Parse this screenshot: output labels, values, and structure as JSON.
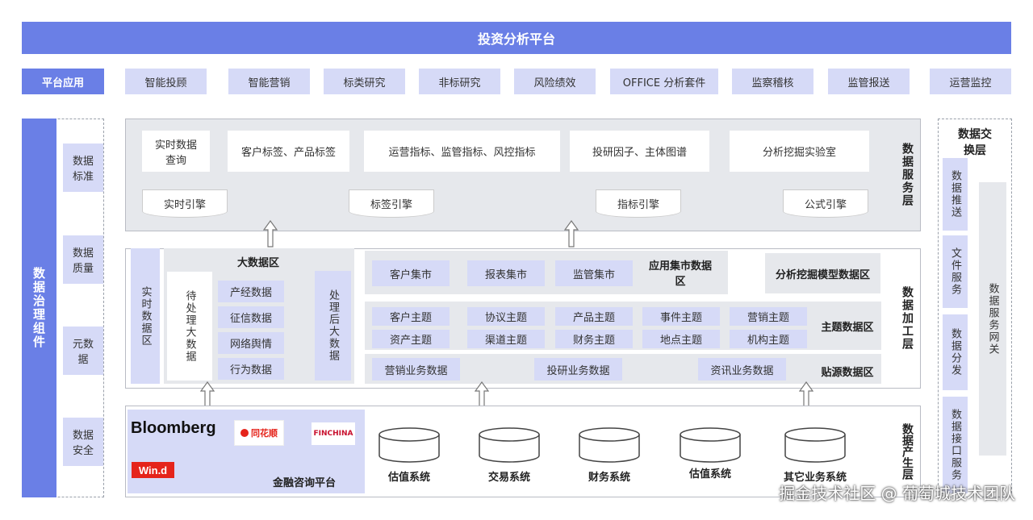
{
  "title": "投资分析平台",
  "platform_apps": {
    "label": "平台应用",
    "items": [
      "智能投顾",
      "智能营销",
      "标类研究",
      "非标研究",
      "风险绩效",
      "OFFICE 分析套件",
      "监察稽核",
      "监管报送",
      "运营监控"
    ]
  },
  "governance": {
    "title": "数据治理组件",
    "items": [
      "数据标准",
      "数据质量",
      "元数据",
      "数据安全"
    ]
  },
  "exchange": {
    "title": "数据交换层",
    "items": [
      "数据推送",
      "文件服务",
      "数据分发",
      "数据接口服务"
    ],
    "gateway": "数据服务网关"
  },
  "service_layer": {
    "title": "数据服务层",
    "boxes": [
      "实时数据查询",
      "客户标签、产品标签",
      "运营指标、监管指标、风控指标",
      "投研因子、主体图谱",
      "分析挖掘实验室"
    ],
    "engines": [
      "实时引擎",
      "标签引擎",
      "指标引擎",
      "公式引擎"
    ]
  },
  "processing_layer": {
    "title": "数据加工层",
    "realtime_zone": "实时数据区",
    "bigdata_zone": {
      "title": "大数据区",
      "pending": "待处理大数据",
      "items": [
        "产经数据",
        "征信数据",
        "网络舆情",
        "行为数据"
      ],
      "processed": "处理后大数据"
    },
    "mart_zone": {
      "items": [
        "客户集市",
        "报表集市",
        "监管集市"
      ],
      "label": "应用集市数据区"
    },
    "mining_zone": "分析挖掘模型数据区",
    "subject_zone": {
      "label": "主题数据区",
      "items": [
        "客户主题",
        "协议主题",
        "产品主题",
        "事件主题",
        "营销主题",
        "资产主题",
        "渠道主题",
        "财务主题",
        "地点主题",
        "机构主题"
      ]
    },
    "source_zone": {
      "label": "贴源数据区",
      "items": [
        "营销业务数据",
        "投研业务数据",
        "资讯业务数据"
      ]
    }
  },
  "production_layer": {
    "title": "数据产生层",
    "vendors": [
      "Bloomberg",
      "Win.d",
      "同花顺",
      "FINCHINA"
    ],
    "vendor_platform": "金融咨询平台",
    "systems": [
      "估值系统",
      "交易系统",
      "财务系统",
      "估值系统",
      "其它业务系统"
    ]
  },
  "watermark": "掘金技术社区 @ 葡萄城技术团队",
  "colors": {
    "accent": "#6a7fe6",
    "lavender": "#d6daf7",
    "panel_gray": "#e6e8ec"
  }
}
